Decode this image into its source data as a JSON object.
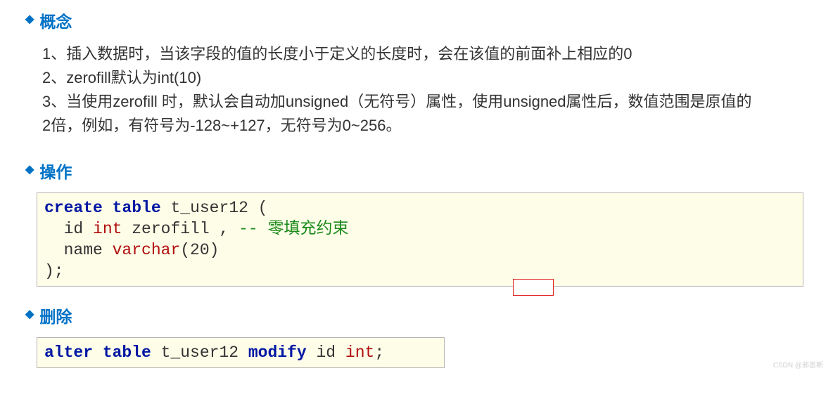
{
  "sections": {
    "concept": {
      "title": "概念"
    },
    "operation": {
      "title": "操作"
    },
    "delete": {
      "title": "删除"
    }
  },
  "concept_items": [
    "1、插入数据时，当该字段的值的长度小于定义的长度时，会在该值的前面补上相应的0",
    "2、zerofill默认为int(10)",
    "3、当使用zerofill 时，默认会自动加unsigned（无符号）属性，使用unsigned属性后，数值范围是原值的2倍，例如，有符号为-128~+127，无符号为0~256。"
  ],
  "code1": {
    "l1_kw1": "create",
    "l1_kw2": "table",
    "l1_rest": " t_user12 (",
    "l2_prefix": "  id ",
    "l2_dt1": "int",
    "l2_mid": " zerofill , ",
    "l2_comment": "-- 零填充约束",
    "l3_prefix": "  name ",
    "l3_dt1": "varchar",
    "l3_rest": "(20)  ",
    "l4": ");"
  },
  "code2": {
    "kw1": "alter",
    "kw2": "table",
    "mid1": " t_user12 ",
    "kw3": "modify",
    "mid2": " id ",
    "dt1": "int",
    "end": ";"
  },
  "watermark": "CSDN @邪恶斯"
}
